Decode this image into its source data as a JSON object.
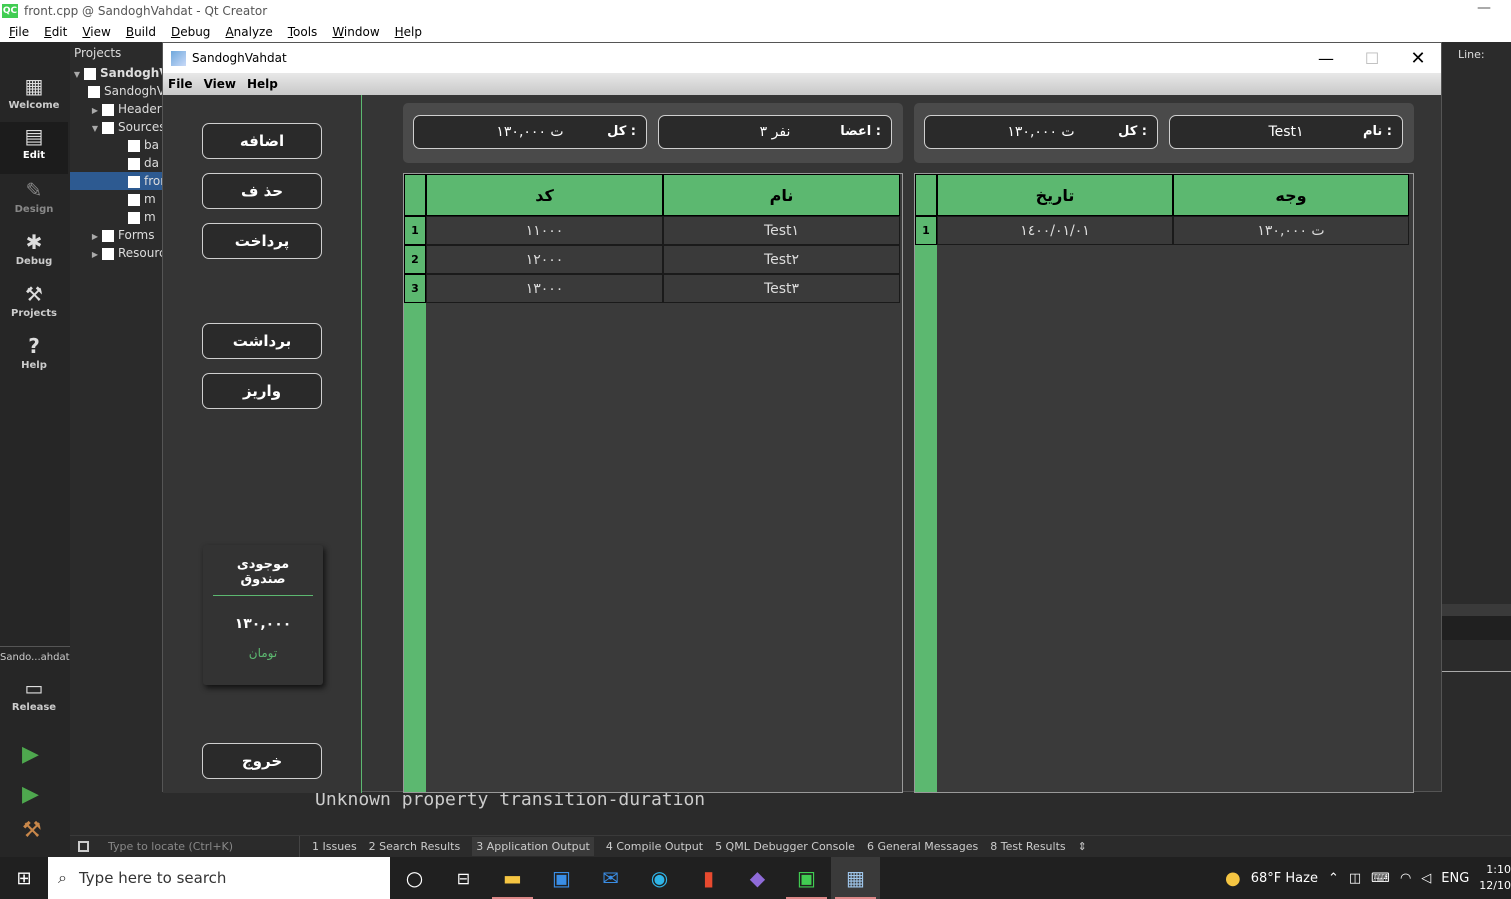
{
  "qt_creator": {
    "title": "front.cpp @ SandoghVahdat - Qt Creator",
    "logo_text": "QC",
    "menu": [
      "File",
      "Edit",
      "View",
      "Build",
      "Debug",
      "Analyze",
      "Tools",
      "Window",
      "Help"
    ],
    "modes": {
      "welcome": "Welcome",
      "edit": "Edit",
      "design": "Design",
      "debug": "Debug",
      "projects": "Projects",
      "help": "Help"
    },
    "kit_label": "Sando...ahdat",
    "build_config": "Release",
    "projects_header": "Projects",
    "tree": [
      {
        "label": "SandoghVahdat",
        "bold": true
      },
      {
        "label": "SandoghVahdat.pro"
      },
      {
        "label": "Headers"
      },
      {
        "label": "Sources"
      },
      {
        "label": "ba"
      },
      {
        "label": "da"
      },
      {
        "label": "front.cpp",
        "selected": true
      },
      {
        "label": "m"
      },
      {
        "label": "m"
      },
      {
        "label": "Forms"
      },
      {
        "label": "Resources"
      }
    ],
    "editor_line_label": "Line:",
    "output_text": "Unknown property transition-duration",
    "locate_placeholder": "Type to locate (Ctrl+K)",
    "output_tabs": [
      {
        "label": "1  Issues"
      },
      {
        "label": "2  Search Results"
      },
      {
        "label": "3  Application Output",
        "active": true
      },
      {
        "label": "4  Compile Output"
      },
      {
        "label": "5  QML Debugger Console"
      },
      {
        "label": "6  General Messages"
      },
      {
        "label": "8  Test Results"
      }
    ]
  },
  "app": {
    "title": "SandoghVahdat",
    "menu": [
      "File",
      "View",
      "Help"
    ],
    "buttons": {
      "add": "اضافه",
      "delete": "حذ ف",
      "pay": "پرداخت",
      "withdraw": "برداشت",
      "deposit": "واریز",
      "exit": "خروج"
    },
    "fund_card": {
      "title": "موجودی صندوق",
      "amount": "۱۳۰,۰۰۰",
      "unit": "تومان"
    },
    "left_panel": {
      "total_label": "کل :",
      "total_value": "۱۳۰,۰۰۰ ت",
      "members_label": "اعضا :",
      "members_value": "۳ نفر",
      "headers": {
        "code": "کد",
        "name": "نام"
      },
      "rows": [
        {
          "num": "1",
          "code": "۱۱۰۰۰",
          "name": "Test۱"
        },
        {
          "num": "2",
          "code": "۱۲۰۰۰",
          "name": "Test۲"
        },
        {
          "num": "3",
          "code": "۱۳۰۰۰",
          "name": "Test۳"
        }
      ]
    },
    "right_panel": {
      "total_label": "کل :",
      "total_value": "۱۳۰,۰۰۰ ت",
      "name_label": "نام :",
      "name_value": "Test۱",
      "headers": {
        "date": "تاریخ",
        "amount": "وجه"
      },
      "rows": [
        {
          "num": "1",
          "date": "۱٤۰۰/۰۱/۰۱",
          "amount": "۱۳۰,۰۰۰ ت"
        }
      ]
    }
  },
  "taskbar": {
    "search_placeholder": "Type here to search",
    "weather": "68°F  Haze",
    "language": "ENG",
    "time": "1:10",
    "date": "12/10"
  }
}
